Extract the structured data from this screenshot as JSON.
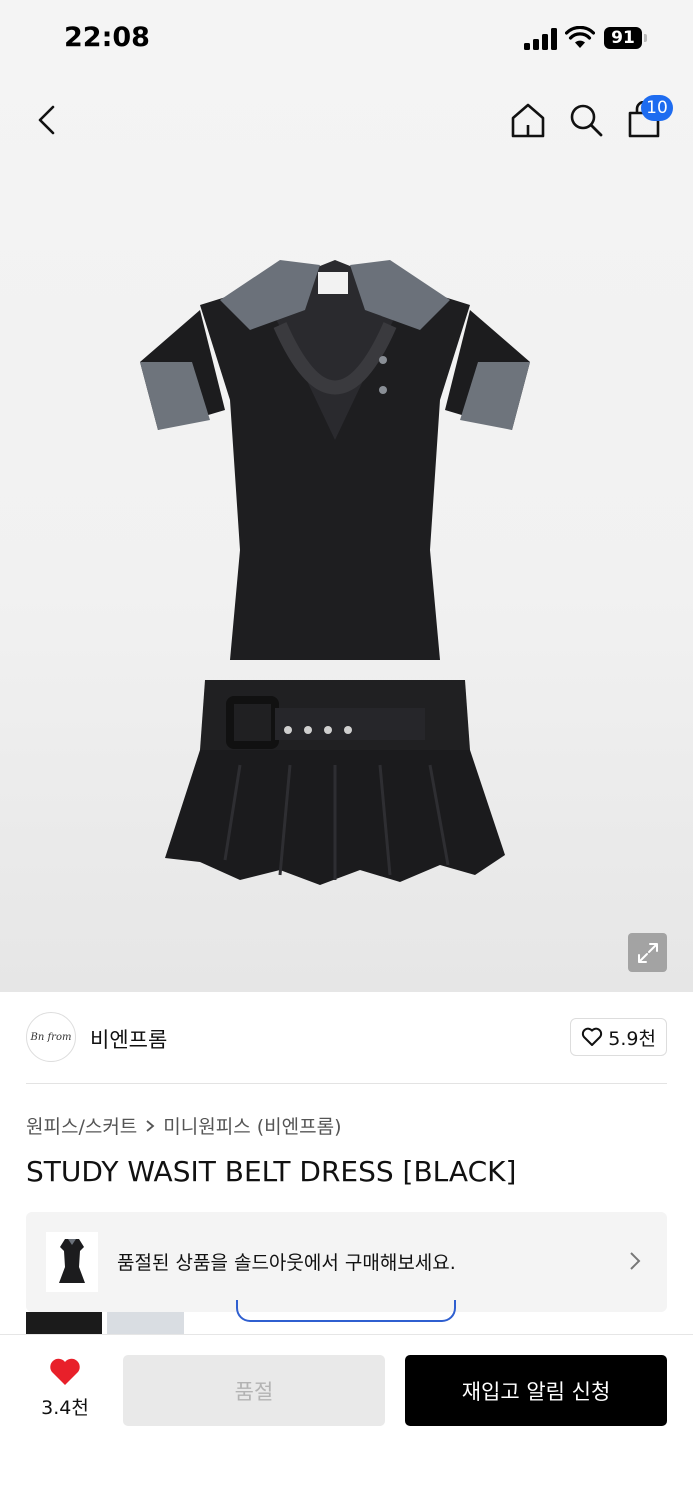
{
  "status_bar": {
    "time": "22:08",
    "battery": "91"
  },
  "header": {
    "cart_count": "10"
  },
  "brand": {
    "name": "비엔프롬",
    "logo_text": "Bn from",
    "likes": "5.9천"
  },
  "breadcrumb": {
    "category": "원피스/스커트",
    "subcategory": "미니원피스 (비엔프롬)"
  },
  "product": {
    "title": "STUDY WASIT BELT DRESS [BLACK]"
  },
  "promo": {
    "text": "품절된 상품을 솔드아웃에서 구매해보세요."
  },
  "bottom_bar": {
    "heart_count": "3.4천",
    "soldout_label": "품절",
    "restock_label": "재입고 알림 신청"
  },
  "colors": {
    "badge": "#1e6cf0",
    "heart": "#e8202a",
    "primary_button": "#000000"
  }
}
